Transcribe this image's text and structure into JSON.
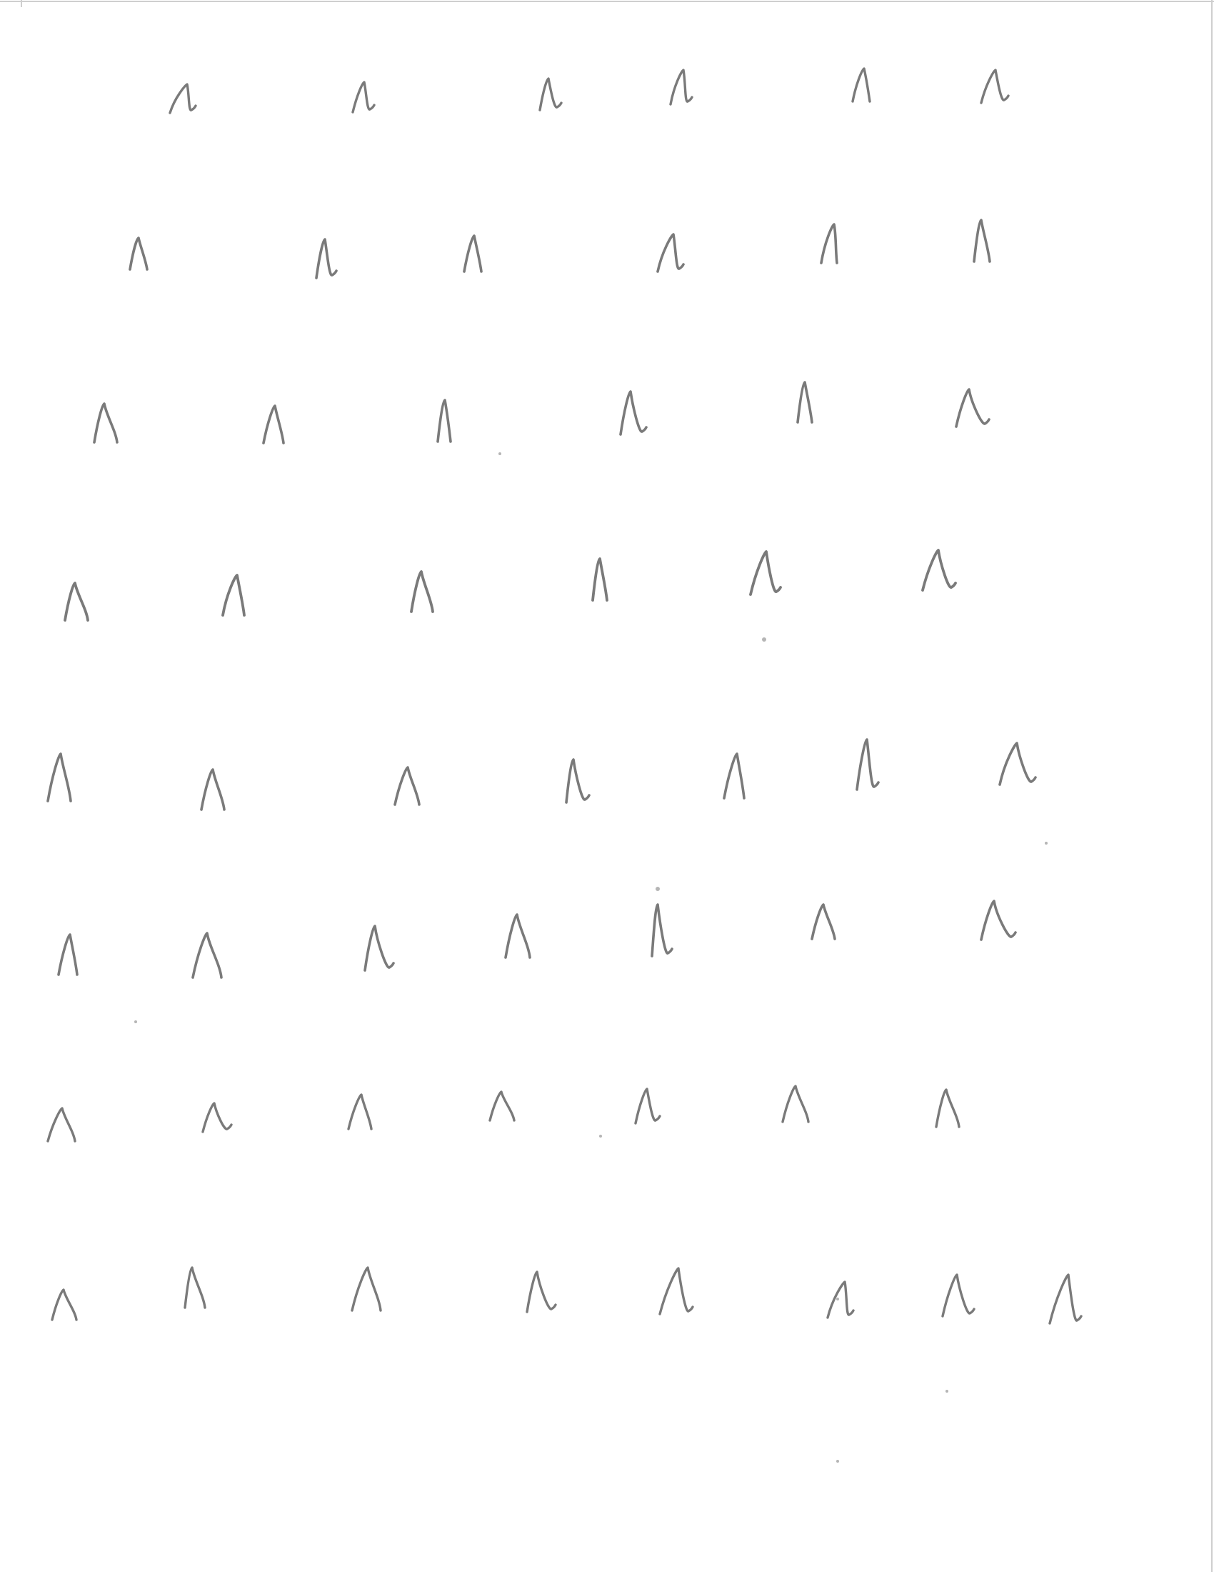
{
  "page": {
    "background_color": "#ffffff",
    "ink_color": "#7a7a7a",
    "speck_color": "#b5b5b5",
    "edge_line_color": "#cfcfcf"
  },
  "handwritten_marks": {
    "glyph": "caret / lambda-like stroke",
    "rows": [
      {
        "row": 1,
        "count": 6
      },
      {
        "row": 2,
        "count": 6
      },
      {
        "row": 3,
        "count": 6
      },
      {
        "row": 4,
        "count": 6
      },
      {
        "row": 5,
        "count": 7
      },
      {
        "row": 6,
        "count": 7
      },
      {
        "row": 7,
        "count": 7
      },
      {
        "row": 8,
        "count": 8
      }
    ],
    "total_count": 53
  }
}
